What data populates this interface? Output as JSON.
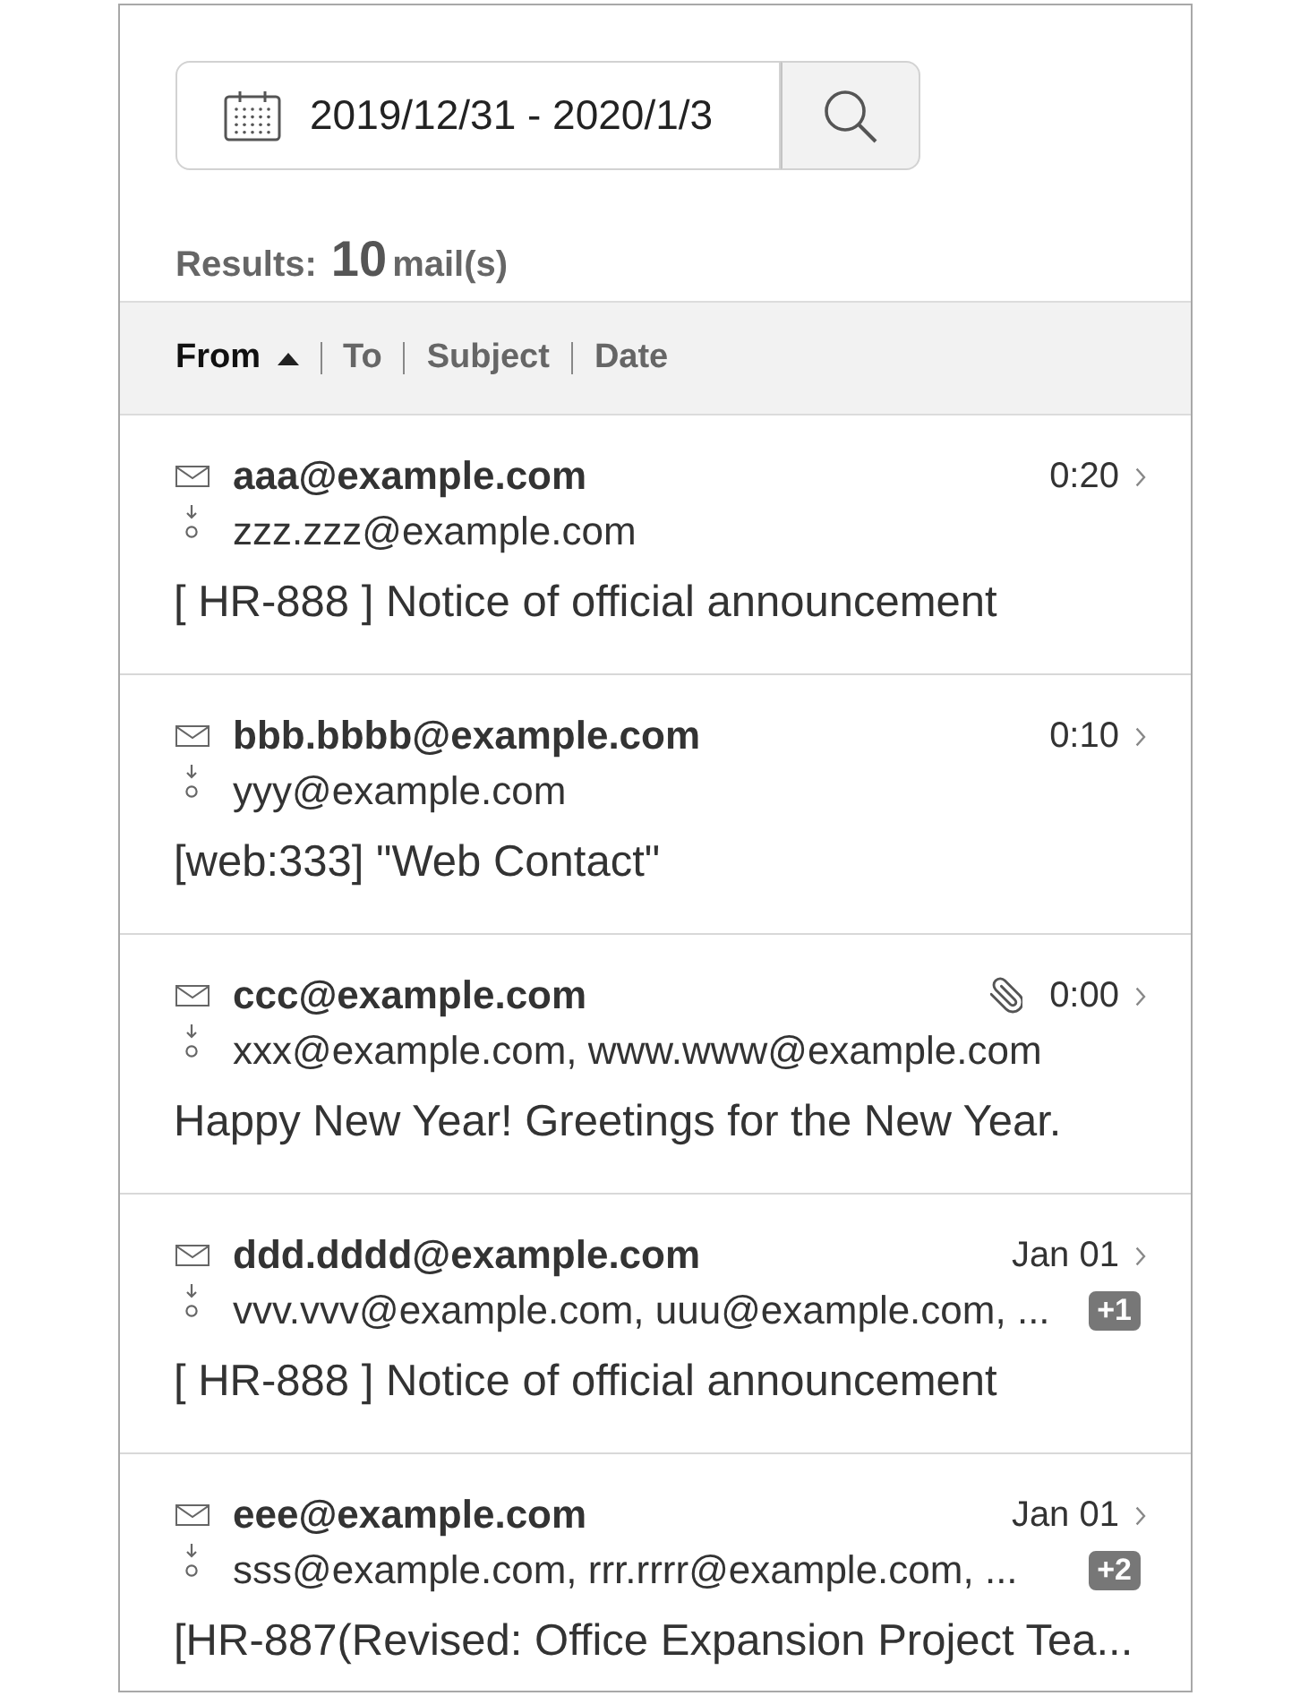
{
  "search": {
    "date_range": "2019/12/31 - 2020/1/3"
  },
  "results": {
    "label": "Results:",
    "count": "10",
    "unit": "mail(s)"
  },
  "sort_bar": {
    "ascending": true,
    "columns": [
      {
        "label": "From",
        "selected": true
      },
      {
        "label": "To",
        "selected": false
      },
      {
        "label": "Subject",
        "selected": false
      },
      {
        "label": "Date",
        "selected": false
      }
    ]
  },
  "mails": [
    {
      "from": "aaa@example.com",
      "time": "0:20",
      "attachment": false,
      "to": "zzz.zzz@example.com",
      "subject": "[ HR-888 ] Notice of official announcement"
    },
    {
      "from": "bbb.bbbb@example.com",
      "time": "0:10",
      "attachment": false,
      "to": "yyy@example.com",
      "subject": "[web:333] \"Web Contact\""
    },
    {
      "from": "ccc@example.com",
      "time": "0:00",
      "attachment": true,
      "to": "xxx@example.com, www.www@example.com",
      "subject": "Happy New Year! Greetings for the New Year."
    },
    {
      "from": "ddd.dddd@example.com",
      "time": "Jan 01",
      "attachment": false,
      "to": "vvv.vvv@example.com, uuu@example.com, ...",
      "more_recipients": "+1",
      "subject": "[ HR-888 ] Notice of official announcement"
    },
    {
      "from": "eee@example.com",
      "time": "Jan 01",
      "attachment": false,
      "to": "sss@example.com, rrr.rrrr@example.com, ...",
      "more_recipients": "+2",
      "subject": "[HR-887(Revised: Office Expansion Project Tea..."
    }
  ]
}
